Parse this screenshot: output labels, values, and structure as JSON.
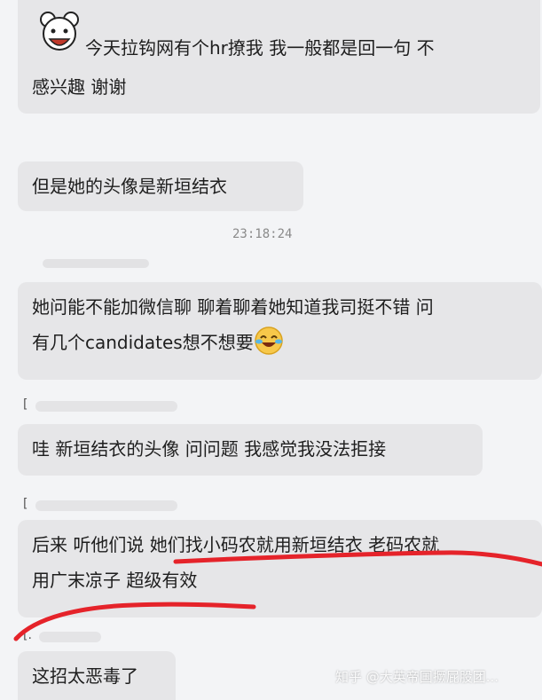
{
  "messages": [
    {
      "text_line1": "今天拉钩网有个hr撩我 我一般都是回一句 不",
      "text_line2": "感兴趣 谢谢"
    },
    {
      "text": "但是她的头像是新垣结衣"
    },
    {
      "text_line1": "她问能不能加微信聊 聊着聊着她知道我司挺不错 问",
      "text_line2": "有几个candidates想不想要"
    },
    {
      "text": "哇 新垣结衣的头像 问问题 我感觉我没法拒接"
    },
    {
      "text_line1": "后来 听他们说 她们找小码农就用新垣结衣 老码农就",
      "text_line2": "用广末凉子 超级有效"
    },
    {
      "text": "这招太恶毒了"
    }
  ],
  "timestamp": "23:18:24",
  "sender_markers": [
    "[",
    "[",
    "[."
  ],
  "watermark": "知乎 @大英帝国撅屁股团...",
  "colors": {
    "bubble": "#e6e6e8",
    "background": "#f3f4f6",
    "annotation": "#e5232a"
  },
  "icons": {
    "avatar": "bear-avatar-icon",
    "emoji": "laughing-tears-emoji-icon"
  }
}
